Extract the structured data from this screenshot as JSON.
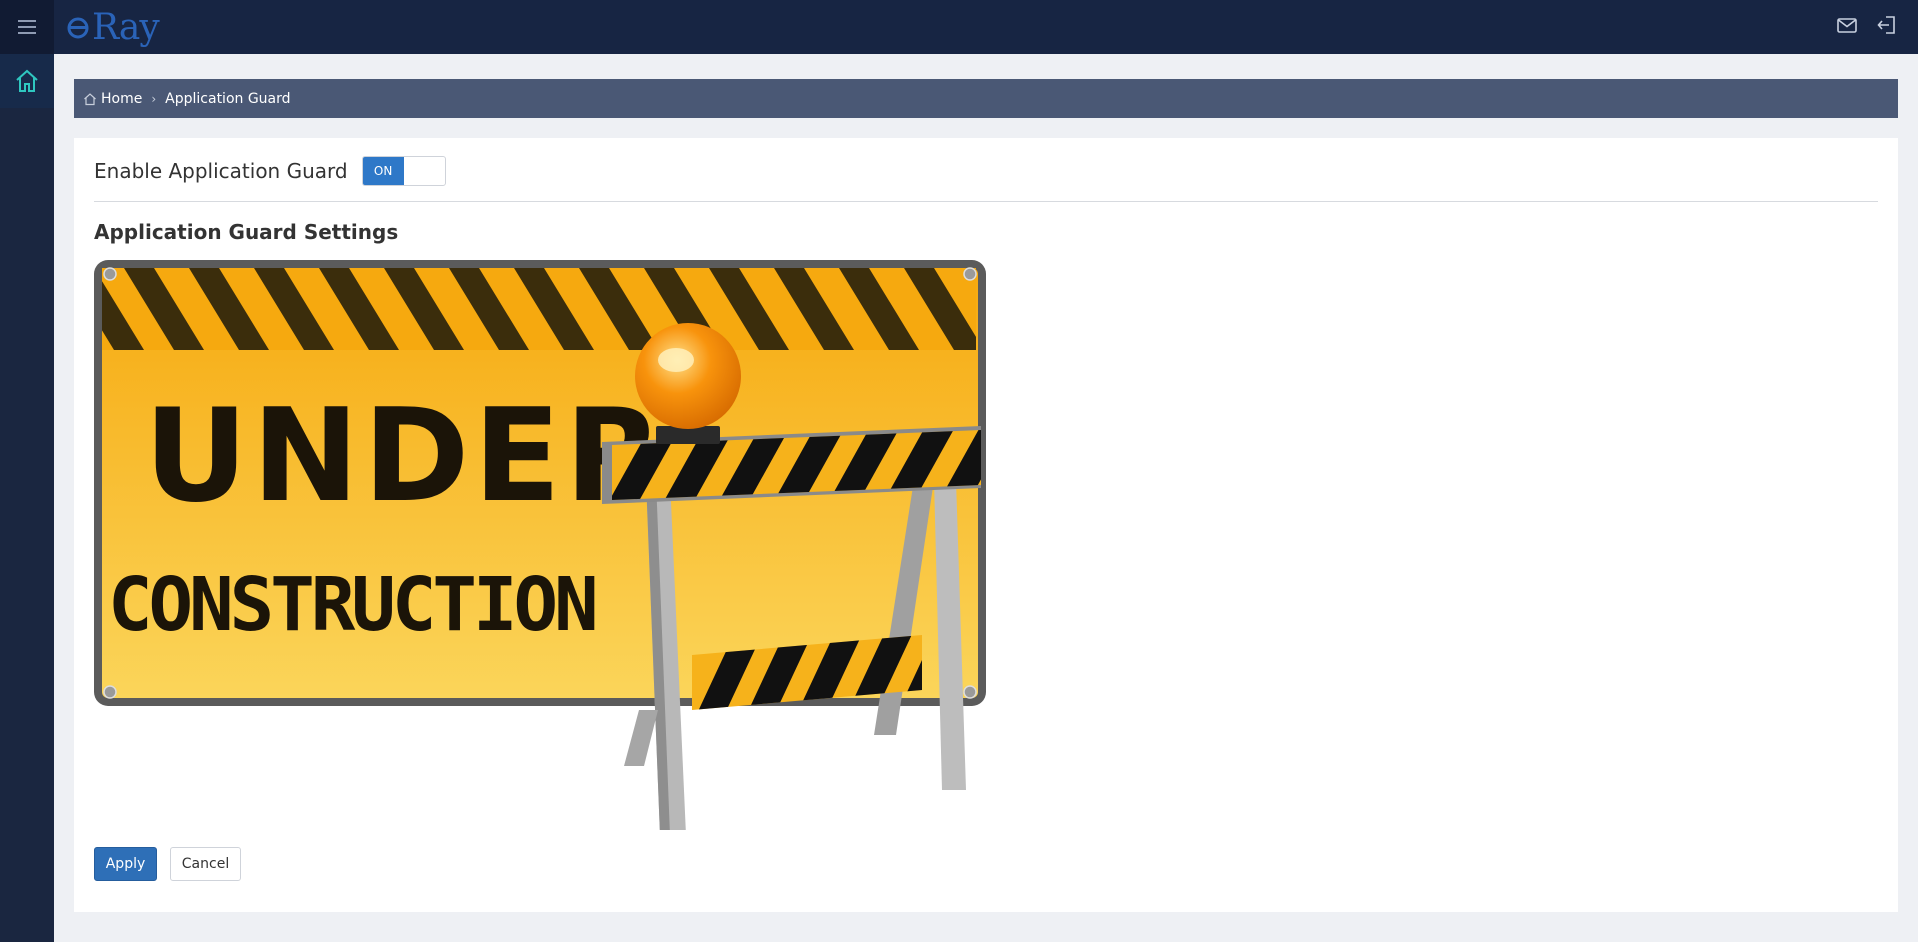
{
  "app": {
    "logo_text": "Ray",
    "brand_color": "#2a63b8"
  },
  "topbar": {
    "menu_icon": "hamburger-menu-icon",
    "icons": [
      "mail-icon",
      "logout-icon"
    ]
  },
  "sidebar": {
    "items": [
      {
        "icon": "home-icon",
        "active": true,
        "accent": "#2fc7c0"
      }
    ]
  },
  "breadcrumb": {
    "home_icon": "home-outline-icon",
    "items": [
      {
        "label": "Home"
      },
      {
        "label": "Application Guard"
      }
    ]
  },
  "settings": {
    "enable_label": "Enable Application Guard",
    "toggle_state": "ON",
    "section_title": "Application Guard Settings",
    "illustration": {
      "line1": "UNDER",
      "line2": "CONSTRUCTION",
      "colors": {
        "sign_yellow": "#f7b521",
        "stripe_dark": "#3b2d0c",
        "frame": "#5b5b5b",
        "light": "#f78a05"
      }
    }
  },
  "actions": {
    "apply_label": "Apply",
    "cancel_label": "Cancel"
  }
}
